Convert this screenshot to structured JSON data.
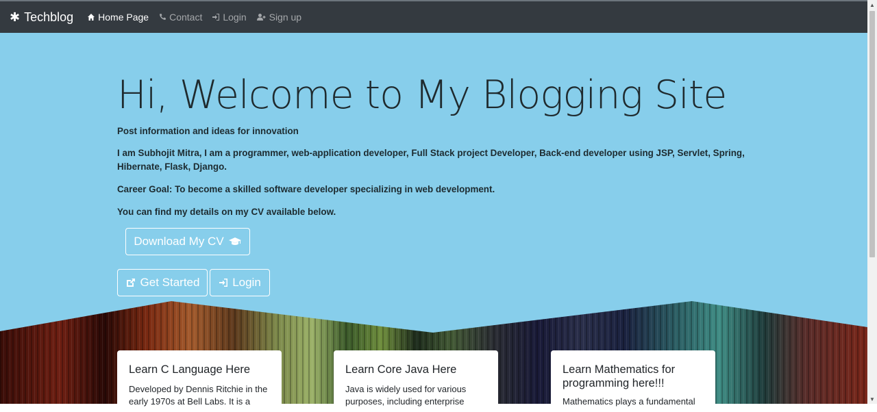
{
  "nav": {
    "brand": "Techblog",
    "brand_icon": "asterisk-icon",
    "links": [
      {
        "label": "Home Page",
        "icon": "home-icon",
        "active": true
      },
      {
        "label": "Contact",
        "icon": "phone-icon",
        "active": false
      },
      {
        "label": "Login",
        "icon": "sign-in-icon",
        "active": false
      },
      {
        "label": "Sign up",
        "icon": "user-plus-icon",
        "active": false
      }
    ]
  },
  "hero": {
    "title": "Hi, Welcome to My Blogging Site",
    "tagline": "Post information and ideas for innovation",
    "intro": "I am Subhojit Mitra, I am a programmer, web-application developer, Full Stack project Developer, Back-end developer using JSP, Servlet, Spring, Hibernate, Flask, Django.",
    "career_goal": "Career Goal: To become a skilled software developer specializing in web development.",
    "cv_note": "You can find my details on my CV available below.",
    "download_label": "Download My CV",
    "get_started_label": "Get Started",
    "login_label": "Login"
  },
  "cards": [
    {
      "title": "Learn C Language Here",
      "text": "Developed by Dennis Ritchie in the early 1970s at Bell Labs. It is a"
    },
    {
      "title": "Learn Core Java Here",
      "text": "Java is widely used for various purposes, including enterprise"
    },
    {
      "title": "Learn Mathematics for programming here!!!",
      "text": "Mathematics plays a fundamental"
    }
  ],
  "colors": {
    "navbar": "#343a40",
    "jumbotron": "#87ceeb",
    "text": "#212529"
  }
}
